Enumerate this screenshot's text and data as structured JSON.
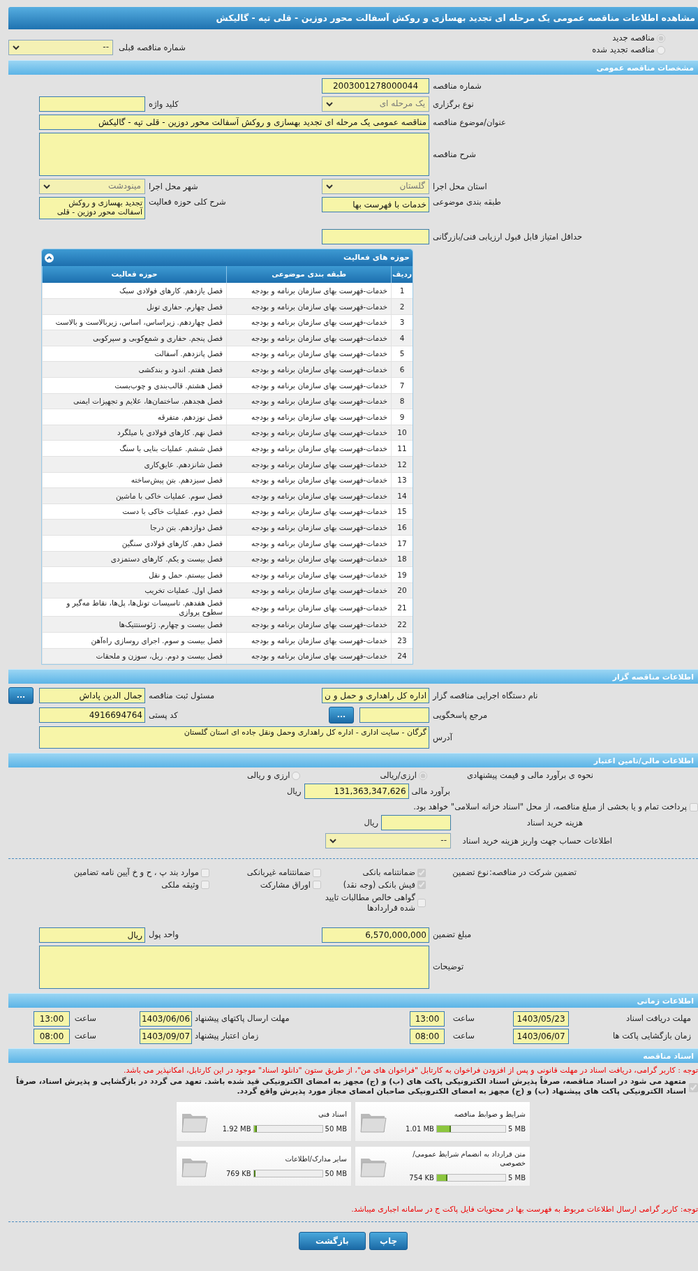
{
  "window": {
    "title": "مشاهده اطلاعات مناقصه عمومی یک مرحله ای تجدید بهسازی و روکش آسفالت محور دوزین - قلی تپه - گالیکش"
  },
  "tender_kind": [
    {
      "label": "مناقصه جدید",
      "selected": true
    },
    {
      "label": "مناقصه تجدید شده",
      "selected": false
    }
  ],
  "previous_tender": {
    "label": "شماره مناقصه قبلی",
    "value": "--"
  },
  "general": {
    "title": "مشخصات مناقصه عمومی",
    "tender_number": {
      "label": "شماره مناقصه",
      "value": "2003001278000044"
    },
    "holding_type": {
      "label": "نوع برگزاری",
      "value": "یک مرحله ای"
    },
    "keyword": {
      "label": "کلید واژه"
    },
    "subject": {
      "label": "عنوان/موضوع مناقصه",
      "value": "مناقصه عمومی یک مرحله ای تجدید بهسازی و روکش آسفالت محور دوزین - قلی تپه - گالیکش"
    },
    "description": {
      "label": "شرح مناقصه"
    },
    "province": {
      "label": "استان محل اجرا",
      "value": "گلستان"
    },
    "city": {
      "label": "شهر محل اجرا",
      "value": "مینودشت"
    },
    "category": {
      "label": "طبقه بندی موضوعی",
      "value": "خدمات با فهرست بها"
    },
    "activity_summary": {
      "label": "شرح کلی حوزه فعالیت",
      "value": "تجدید بهسازی و روکش آسفالت محور دوزین - قلی"
    },
    "min_score": {
      "label": "حداقل امتیاز قابل قبول ارزیابی فنی/بازرگانی"
    }
  },
  "activities": {
    "title": "حوزه های فعالیت",
    "columns": [
      "ردیف",
      "طبقه بندی موضوعی",
      "حوزه فعالیت"
    ],
    "rows": [
      {
        "number": "1",
        "category": "خدمات-فهرست بهای سازمان برنامه و بودجه",
        "activity": "فصل یازدهم. کارهای فولادی سبک"
      },
      {
        "number": "2",
        "category": "خدمات-فهرست بهای سازمان برنامه و بودجه",
        "activity": "فصل چهارم. حفاری تونل"
      },
      {
        "number": "3",
        "category": "خدمات-فهرست بهای سازمان برنامه و بودجه",
        "activity": "فصل چهاردهم. زیراساس، اساس، زیربالاست و بالاست"
      },
      {
        "number": "4",
        "category": "خدمات-فهرست بهای سازمان برنامه و بودجه",
        "activity": "فصل پنجم. حفاری و شمع‌کوبی و سپرکوبی"
      },
      {
        "number": "5",
        "category": "خدمات-فهرست بهای سازمان برنامه و بودجه",
        "activity": "فصل پانزدهم. آسفالت"
      },
      {
        "number": "6",
        "category": "خدمات-فهرست بهای سازمان برنامه و بودجه",
        "activity": "فصل هفتم. اندود و بندکشی"
      },
      {
        "number": "7",
        "category": "خدمات-فهرست بهای سازمان برنامه و بودجه",
        "activity": "فصل هشتم. قالب‌بندی و چوب‌بست"
      },
      {
        "number": "8",
        "category": "خدمات-فهرست بهای سازمان برنامه و بودجه",
        "activity": "فصل هجدهم. ساختمان‌ها، علایم و تجهیزات ایمنی"
      },
      {
        "number": "9",
        "category": "خدمات-فهرست بهای سازمان برنامه و بودجه",
        "activity": "فصل نوزدهم. متفرقه"
      },
      {
        "number": "10",
        "category": "خدمات-فهرست بهای سازمان برنامه و بودجه",
        "activity": "فصل نهم. کارهای فولادی با میلگرد"
      },
      {
        "number": "11",
        "category": "خدمات-فهرست بهای سازمان برنامه و بودجه",
        "activity": "فصل ششم. عملیات بنایی با سنگ"
      },
      {
        "number": "12",
        "category": "خدمات-فهرست بهای سازمان برنامه و بودجه",
        "activity": "فصل شانزدهم. عایق‌کاری"
      },
      {
        "number": "13",
        "category": "خدمات-فهرست بهای سازمان برنامه و بودجه",
        "activity": "فصل سیزدهم. بتن پیش‌ساخته"
      },
      {
        "number": "14",
        "category": "خدمات-فهرست بهای سازمان برنامه و بودجه",
        "activity": "فصل سوم. عملیات خاکی با ماشین"
      },
      {
        "number": "15",
        "category": "خدمات-فهرست بهای سازمان برنامه و بودجه",
        "activity": "فصل دوم. عملیات خاکی با دست"
      },
      {
        "number": "16",
        "category": "خدمات-فهرست بهای سازمان برنامه و بودجه",
        "activity": "فصل دوازدهم. بتن درجا"
      },
      {
        "number": "17",
        "category": "خدمات-فهرست بهای سازمان برنامه و بودجه",
        "activity": "فصل دهم. کارهای فولادی سنگین"
      },
      {
        "number": "18",
        "category": "خدمات-فهرست بهای سازمان برنامه و بودجه",
        "activity": "فصل بیست و یکم. کارهای دستمزدی"
      },
      {
        "number": "19",
        "category": "خدمات-فهرست بهای سازمان برنامه و بودجه",
        "activity": "فصل بیستم. حمل و نقل"
      },
      {
        "number": "20",
        "category": "خدمات-فهرست بهای سازمان برنامه و بودجه",
        "activity": "فصل اول. عملیات تخریب"
      },
      {
        "number": "21",
        "category": "خدمات-فهرست بهای سازمان برنامه و بودجه",
        "activity": "فصل هفدهم. تاسیسات تونل‌ها، پل‌ها، نقاط مه‌گیر و سطوح پروازی"
      },
      {
        "number": "22",
        "category": "خدمات-فهرست بهای سازمان برنامه و بودجه",
        "activity": "فصل بیست و چهارم. ژئوسنتتیک‌ها"
      },
      {
        "number": "23",
        "category": "خدمات-فهرست بهای سازمان برنامه و بودجه",
        "activity": "فصل بیست و سوم. اجرای روسازی راه‌آهن"
      },
      {
        "number": "24",
        "category": "خدمات-فهرست بهای سازمان برنامه و بودجه",
        "activity": "فصل بیست و دوم. ریل، سوزن و ملحقات"
      }
    ]
  },
  "organizer": {
    "title": "اطلاعات مناقصه گزار",
    "organization": {
      "label": "نام دستگاه اجرایی مناقصه گزار",
      "value": "اداره کل راهداری و حمل و ن"
    },
    "registrar": {
      "label": "مسئول ثبت مناقصه",
      "value": "جمال الدین پاداش",
      "button": "..."
    },
    "reference": {
      "label": "مرجع پاسخگویی",
      "button": "..."
    },
    "postal_code": {
      "label": "کد پستی",
      "value": "4916694764"
    },
    "address": {
      "label": "آدرس",
      "value": "گرگان - سایت اداری - اداره کل راهداری وحمل ونقل جاده ای استان گلستان"
    }
  },
  "finance": {
    "title": "اطلاعات مالی/تامین اعتبار",
    "estimate_method": {
      "label": "نحوه ی برآورد مالی و قیمت پیشنهادی",
      "options": [
        {
          "label": "ارزی/ریالی",
          "selected": true
        },
        {
          "label": "ارزی و ریالی",
          "selected": false
        }
      ]
    },
    "estimate": {
      "label": "برآورد مالی",
      "value": "131,363,347,626",
      "unit": "ریال"
    },
    "treasury": {
      "label": "پرداخت تمام و یا بخشی از مبلغ مناقصه، از محل \"اسناد خزانه اسلامی\" خواهد بود.",
      "checked": false
    },
    "document_fee": {
      "label": "هزینه خرید اسناد",
      "unit": "ریال"
    },
    "account": {
      "label": "اطلاعات حساب جهت واریز هزینه خرید اسناد",
      "value": "--"
    },
    "guarantee": {
      "label": "تضمین شرکت در مناقصه:",
      "type_label": "نوع تضمین",
      "options": [
        {
          "label": "ضمانتنامه بانکی",
          "checked": true
        },
        {
          "label": "ضمانتنامه غیربانکی",
          "checked": false
        },
        {
          "label": "موارد بند پ ، ح و خ آیین نامه تضامین",
          "checked": false
        },
        {
          "label": "فیش بانکی (وجه نقد)",
          "checked": true
        },
        {
          "label": "اوراق مشارکت",
          "checked": false
        },
        {
          "label": "وثیقه ملکی",
          "checked": false
        },
        {
          "label": "گواهی خالص مطالبات تایید شده قراردادها",
          "checked": false
        }
      ]
    },
    "guarantee_amount": {
      "label": "مبلغ تضمین",
      "value": "6,570,000,000"
    },
    "currency": {
      "label": "واحد پول",
      "value": "ریال"
    },
    "notes": {
      "label": "توضیحات"
    }
  },
  "timing": {
    "title": "اطلاعات زمانی",
    "items": [
      {
        "label": "مهلت دریافت اسناد",
        "date": "1403/05/23",
        "time_label": "ساعت",
        "time": "13:00"
      },
      {
        "label": "مهلت ارسال پاکتهای پیشنهاد",
        "date": "1403/06/06",
        "time_label": "ساعت",
        "time": "13:00"
      },
      {
        "label": "زمان بازگشایی پاکت ها",
        "date": "1403/06/07",
        "time_label": "ساعت",
        "time": "08:00"
      },
      {
        "label": "زمان اعتبار پیشنهاد",
        "date": "1403/09/07",
        "time_label": "ساعت",
        "time": "08:00"
      }
    ]
  },
  "documents": {
    "title": "اسناد مناقصه",
    "notice": "توجه : کاربر گرامی، دریافت اسناد در مهلت قانونی و پس از افزودن فراخوان به کارتابل \"فراخوان های من\"، از طریق ستون \"دانلود اسناد\" موجود در این کارتابل، امکانپذیر می باشد.",
    "commitment": {
      "label": "متعهد می شود در اسناد مناقصه، صرفاً پذیرش اسناد الکترونیکی پاکت های (ب) و (ج) مجهز به امضای الکترونیکی قید شده باشد. تعهد می گردد در بازگشایی و پذیرش اسناد، صرفاً اسناد الکترونیکی پاکت های پیشنهاد (ب) و (ج) مجهز به امضای الکترونیکی صاحبان امضای مجاز مورد پذیرش واقع گردد.",
      "checked": true
    },
    "files": [
      {
        "name": "شرایط و ضوابط مناقصه",
        "size": "1.01 MB",
        "max": "5 MB",
        "level": 0.2
      },
      {
        "name": "اسناد فنی",
        "size": "1.92 MB",
        "max": "50 MB",
        "level": 0.04
      },
      {
        "name": "متن قرارداد به انضمام شرایط عمومی/خصوصی",
        "size": "754 KB",
        "max": "5 MB",
        "level": 0.15
      },
      {
        "name": "سایر مدارک/اطلاعات",
        "size": "769 KB",
        "max": "50 MB",
        "level": 0.015
      }
    ],
    "footer_notice": "توجه: کاربر گرامی ارسال اطلاعات مربوط به فهرست بها در محتویات فایل پاکت ج در سامانه اجباری میباشد."
  },
  "buttons": [
    {
      "kind": "print",
      "label": "چاپ"
    },
    {
      "kind": "back",
      "label": "بازگشت"
    }
  ]
}
